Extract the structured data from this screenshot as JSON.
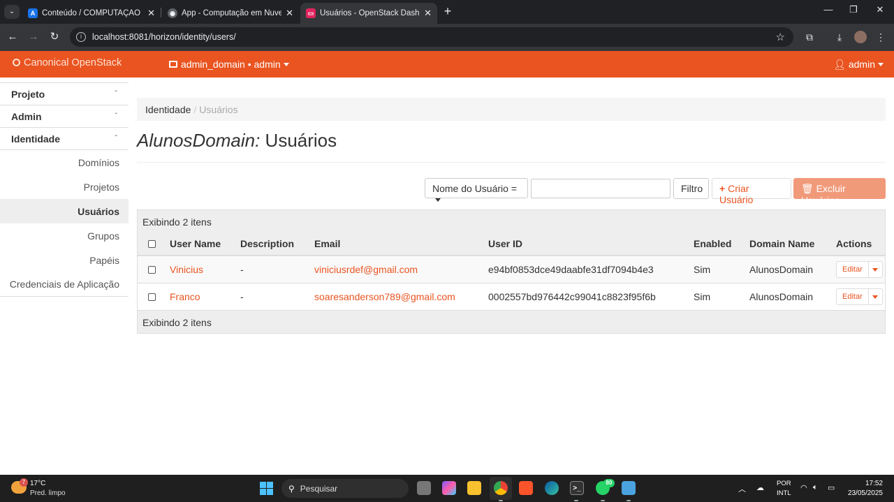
{
  "browser": {
    "tabs": [
      {
        "title": "Conteúdo / COMPUTAÇÃO EM",
        "favicon": "A",
        "favicon_color": "#1a73e8"
      },
      {
        "title": "App - Computação em Nuvem",
        "favicon": "◉",
        "favicon_color": "#5f6368"
      },
      {
        "title": "Usuários - OpenStack Dashboard",
        "favicon": "▭",
        "favicon_color": "#e0245e"
      }
    ],
    "url": "localhost:8081/horizon/identity/users/"
  },
  "header": {
    "brand": "Canonical OpenStack",
    "context": "admin_domain • admin",
    "user": "admin",
    "color": "#e95420"
  },
  "sidebar": {
    "panels": [
      {
        "label": "Projeto",
        "chevron": "ˇ"
      },
      {
        "label": "Admin",
        "chevron": "ˇ"
      },
      {
        "label": "Identidade",
        "chevron": "ˆ"
      }
    ],
    "items": [
      {
        "label": "Domínios"
      },
      {
        "label": "Projetos"
      },
      {
        "label": "Usuários"
      },
      {
        "label": "Grupos"
      },
      {
        "label": "Papéis"
      },
      {
        "label": "Credenciais de Aplicação"
      }
    ]
  },
  "breadcrumb": {
    "root": "Identidade",
    "separator": "/",
    "current": "Usuários"
  },
  "title": {
    "domain": "AlunosDomain:",
    "page": "Usuários"
  },
  "filters": {
    "field": "Nome do Usuário =",
    "value": "",
    "filter_button": "Filtro",
    "create_button": "Criar Usuário",
    "delete_button": "Excluir Usuários"
  },
  "table": {
    "caption": "Exibindo 2 itens",
    "footer": "Exibindo 2 itens",
    "columns": [
      "User Name",
      "Description",
      "Email",
      "User ID",
      "Enabled",
      "Domain Name",
      "Actions"
    ],
    "rows": [
      {
        "name": "Vinicius",
        "description": "-",
        "email": "viniciusrdef@gmail.com",
        "id": "e94bf0853dce49daabfe31df7094b4e3",
        "enabled": "Sim",
        "domain": "AlunosDomain",
        "action": "Editar"
      },
      {
        "name": "Franco",
        "description": "-",
        "email": "soaresanderson789@gmail.com",
        "id": "0002557bd976442c99041c8823f95f6b",
        "enabled": "Sim",
        "domain": "AlunosDomain",
        "action": "Editar"
      }
    ]
  },
  "taskbar": {
    "temperature": "17°C",
    "weather": "Pred. limpo",
    "weather_badge": "7",
    "search": "Pesquisar",
    "whatsapp_badge": "80",
    "lang1": "POR",
    "lang2": "INTL",
    "time": "17:52",
    "date": "23/05/2025"
  }
}
